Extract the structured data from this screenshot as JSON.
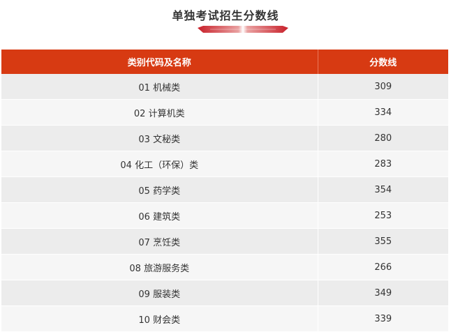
{
  "title": "单独考试招生分数线",
  "colors": {
    "header_bg": "#d73a12",
    "deco_red": "#c8202a"
  },
  "table": {
    "headers": [
      "类别代码及名称",
      "分数线"
    ],
    "rows": [
      {
        "category": "01 机械类",
        "score": "309"
      },
      {
        "category": "02 计算机类",
        "score": "334"
      },
      {
        "category": "03 文秘类",
        "score": "280"
      },
      {
        "category": "04 化工（环保）类",
        "score": "283"
      },
      {
        "category": "05 药学类",
        "score": "354"
      },
      {
        "category": "06 建筑类",
        "score": "253"
      },
      {
        "category": "07 烹饪类",
        "score": "355"
      },
      {
        "category": "08 旅游服务类",
        "score": "266"
      },
      {
        "category": "09 服装类",
        "score": "349"
      },
      {
        "category": "10 财会类",
        "score": "339"
      }
    ]
  }
}
